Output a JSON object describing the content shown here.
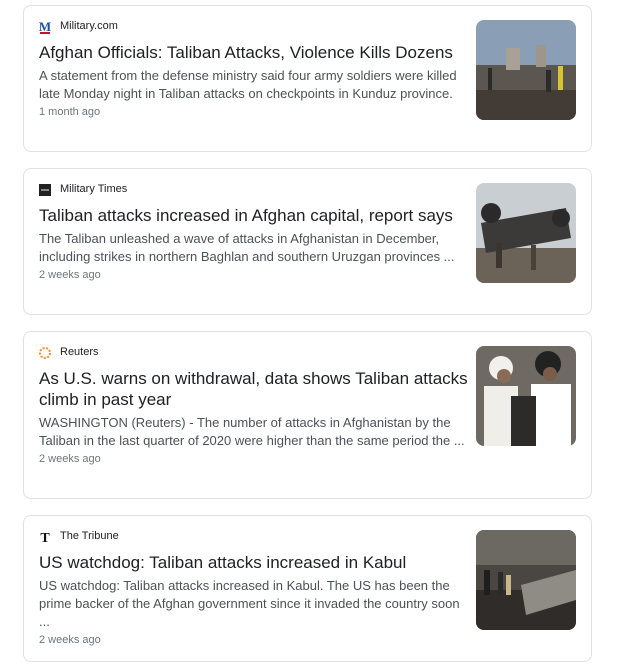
{
  "articles": [
    {
      "source": "Military.com",
      "headline": "Afghan Officials: Taliban Attacks, Violence Kills Dozens",
      "snippet": "A statement from the defense ministry said four army soldiers were killed late Monday night in Taliban attacks on checkpoints in Kunduz province.",
      "time": "1 month ago"
    },
    {
      "source": "Military Times",
      "headline": "Taliban attacks increased in Afghan capital, report says",
      "snippet": "The Taliban unleashed a wave of attacks in Afghanistan in December, including strikes in northern Baghlan and southern Uruzgan provinces ...",
      "time": "2 weeks ago"
    },
    {
      "source": "Reuters",
      "headline": "As U.S. warns on withdrawal, data shows Taliban attacks climb in past year",
      "snippet": "WASHINGTON (Reuters) - The number of attacks in Afghanistan by the Taliban in the last quarter of 2020 were higher than the same period the ...",
      "time": "2 weeks ago"
    },
    {
      "source": "The Tribune",
      "headline": "US watchdog: Taliban attacks increased in Kabul",
      "snippet": "US watchdog: Taliban attacks increased in Kabul. The US has been the prime backer of the Afghan government since it invaded the country soon ...",
      "time": "2 weeks ago"
    }
  ]
}
